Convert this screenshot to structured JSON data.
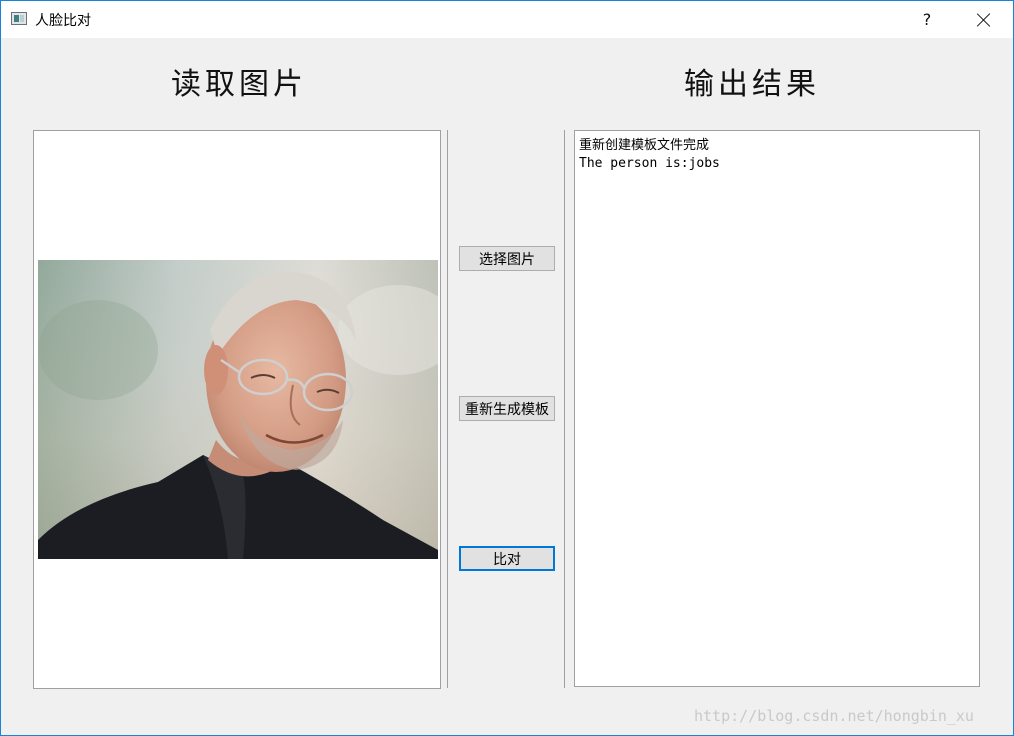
{
  "window": {
    "title": "人脸比对",
    "help_label": "?"
  },
  "headings": {
    "left": "读取图片",
    "right": "输出结果"
  },
  "buttons": {
    "select_image": "选择图片",
    "regenerate_template": "重新生成模板",
    "compare": "比对"
  },
  "output": {
    "lines": [
      "重新创建模板文件完成",
      "The person is:jobs"
    ]
  },
  "watermark": "http://blog.csdn.net/hongbin_xu",
  "colors": {
    "window_border": "#1883d7",
    "focus_accent": "#0078d7",
    "background": "#f0f0f0"
  }
}
